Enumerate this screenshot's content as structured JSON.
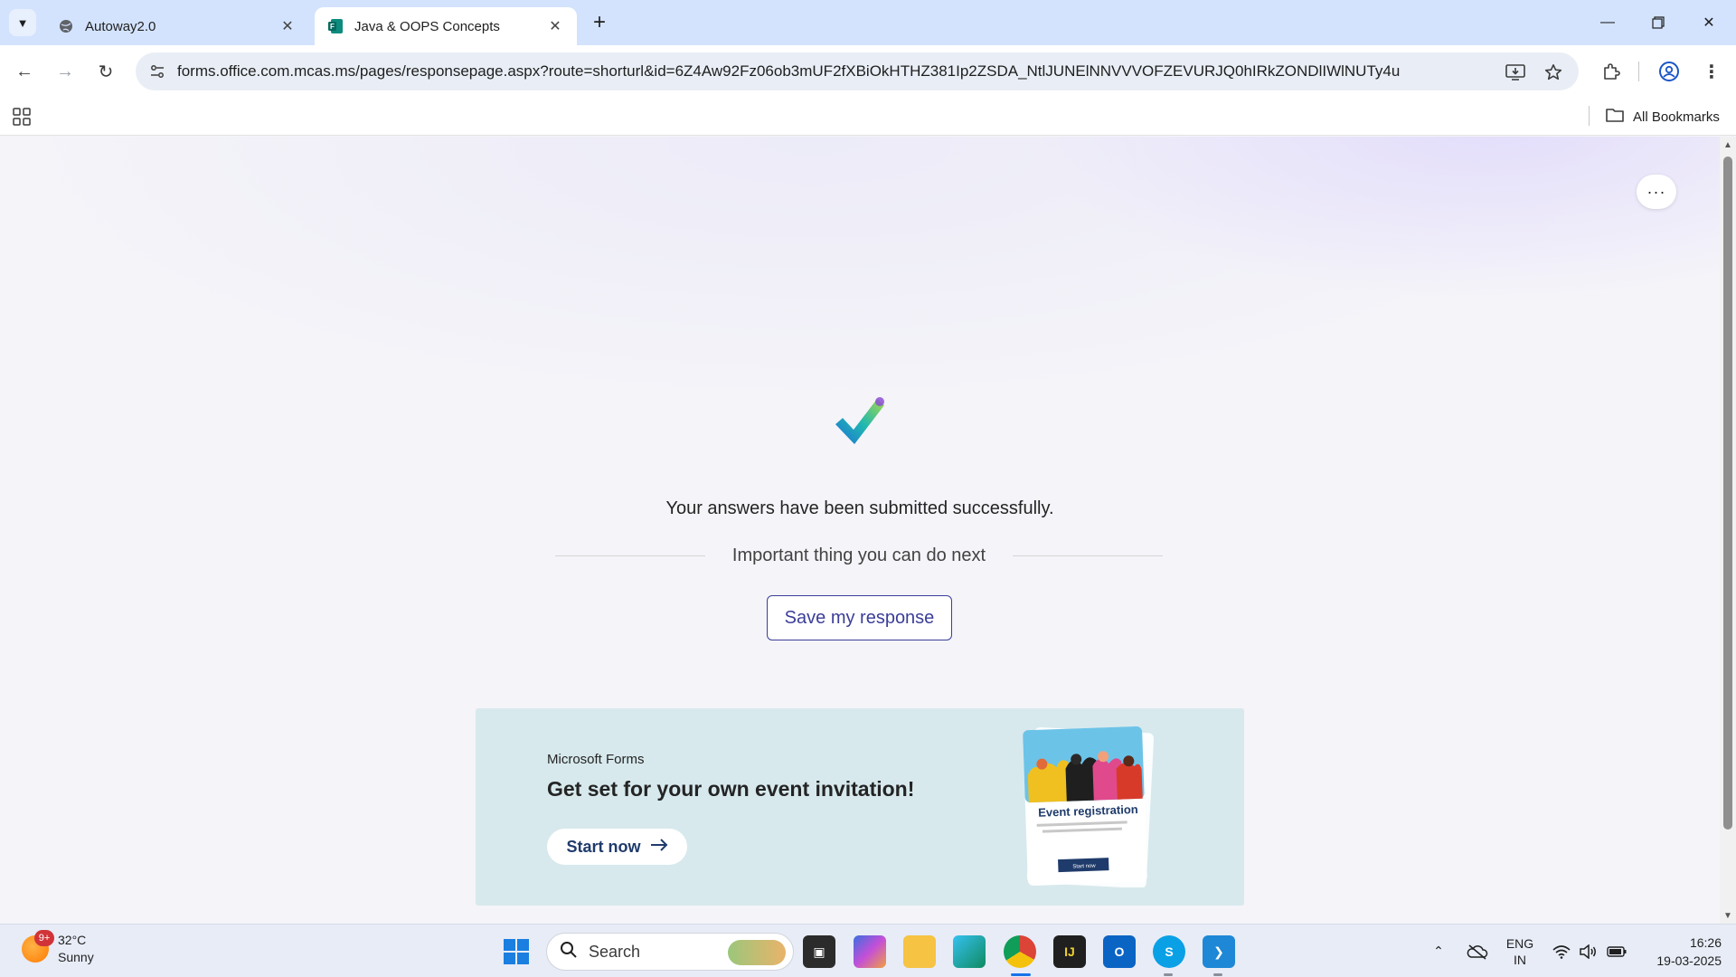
{
  "browser": {
    "tabs": [
      {
        "title": "Autoway2.0",
        "active": false
      },
      {
        "title": "Java & OOPS Concepts",
        "active": true
      }
    ],
    "url": "forms.office.com.mcas.ms/pages/responsepage.aspx?route=shorturl&id=6Z4Aw92Fz06ob3mUF2fXBiOkHTHZ381Ip2ZSDA_NtlJUNElNNVVVOFZEVURJQ0hIRkZONDlIWlNUTy4u",
    "bookmarks_label": "All Bookmarks"
  },
  "page": {
    "more_label": "···",
    "success_message": "Your answers have been submitted successfully.",
    "next_label": "Important thing you can do next",
    "save_button": "Save my response",
    "promo": {
      "brand": "Microsoft Forms",
      "title": "Get set for your own event invitation!",
      "button": "Start now",
      "card_title": "Event registration",
      "card_button": "Start now"
    }
  },
  "taskbar": {
    "weather": {
      "badge": "9+",
      "temp": "32°C",
      "condition": "Sunny"
    },
    "search_label": "Search",
    "language": {
      "line1": "ENG",
      "line2": "IN"
    },
    "time": "16:26",
    "date": "19-03-2025"
  },
  "colors": {
    "accent": "#3b3e99",
    "tabbar": "#d3e3fd",
    "promo_bg": "#d7e9ed"
  }
}
